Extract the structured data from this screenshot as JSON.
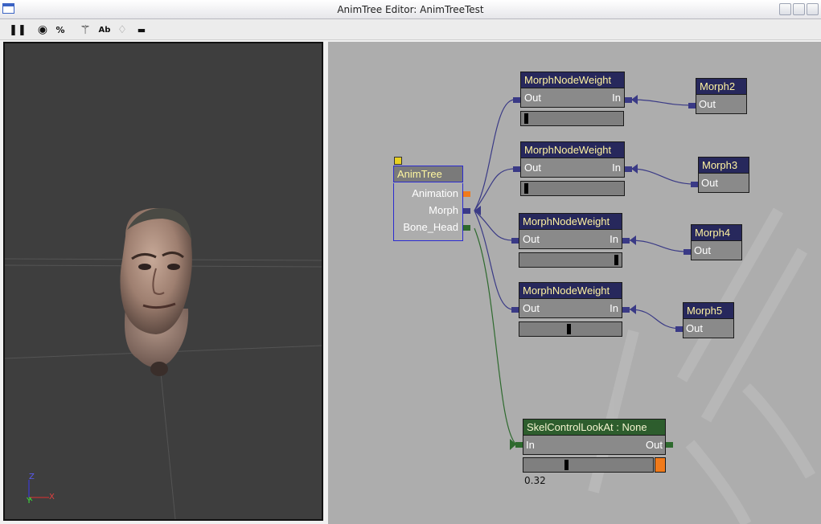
{
  "window": {
    "title": "AnimTree Editor: AnimTreeTest"
  },
  "toolbar": {
    "items": [
      {
        "name": "pause-button",
        "glyph": "❚❚"
      },
      {
        "name": "eye-button",
        "glyph": "◉"
      },
      {
        "name": "percent-button",
        "glyph": "%"
      },
      {
        "name": "skeleton-button",
        "glyph": "⚚"
      },
      {
        "name": "text-button",
        "glyph": "Ab"
      },
      {
        "name": "light-button",
        "glyph": "♢"
      },
      {
        "name": "minus-button",
        "glyph": "▬"
      }
    ]
  },
  "viewport": {
    "axis": {
      "z": "Z",
      "y": "Y",
      "x": "X"
    }
  },
  "graph": {
    "animtree": {
      "title": "AnimTree",
      "inputs": [
        "Animation",
        "Morph",
        "Bone_Head"
      ]
    },
    "weight_nodes": [
      {
        "title": "MorphNodeWeight",
        "out": "Out",
        "in": "In",
        "weight": 0.02
      },
      {
        "title": "MorphNodeWeight",
        "out": "Out",
        "in": "In",
        "weight": 0.02
      },
      {
        "title": "MorphNodeWeight",
        "out": "Out",
        "in": "In",
        "weight": 0.98
      },
      {
        "title": "MorphNodeWeight",
        "out": "Out",
        "in": "In",
        "weight": 0.48
      }
    ],
    "morph_nodes": [
      {
        "title": "Morph2",
        "out": "Out"
      },
      {
        "title": "Morph3",
        "out": "Out"
      },
      {
        "title": "Morph4",
        "out": "Out"
      },
      {
        "title": "Morph5",
        "out": "Out"
      }
    ],
    "skel": {
      "title": "SkelControlLookAt : None",
      "in": "In",
      "out": "Out",
      "strength": 0.32,
      "value_label": "0.32"
    }
  }
}
